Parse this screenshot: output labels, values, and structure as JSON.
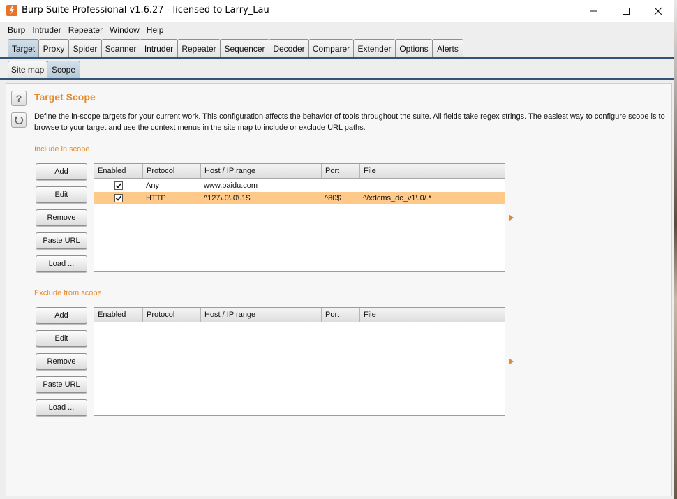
{
  "window": {
    "title": "Burp Suite Professional v1.6.27 - licensed to Larry_Lau"
  },
  "menu": [
    "Burp",
    "Intruder",
    "Repeater",
    "Window",
    "Help"
  ],
  "main_tabs": [
    "Target",
    "Proxy",
    "Spider",
    "Scanner",
    "Intruder",
    "Repeater",
    "Sequencer",
    "Decoder",
    "Comparer",
    "Extender",
    "Options",
    "Alerts"
  ],
  "active_main_tab": "Target",
  "sub_tabs": [
    "Site map",
    "Scope"
  ],
  "active_sub_tab": "Scope",
  "scope": {
    "title": "Target Scope",
    "description": "Define the in-scope targets for your current work. This configuration affects the behavior of tools throughout the suite. All fields take regex strings. The easiest way to configure scope is to browse to your target and use the context menus in the site map to include or exclude URL paths.",
    "help_icon": "?",
    "include": {
      "label": "Include in scope",
      "buttons": [
        "Add",
        "Edit",
        "Remove",
        "Paste URL",
        "Load ..."
      ],
      "columns": [
        "Enabled",
        "Protocol",
        "Host / IP range",
        "Port",
        "File"
      ],
      "rows": [
        {
          "enabled": true,
          "protocol": "Any",
          "host": "www.baidu.com",
          "port": "",
          "file": "",
          "selected": false
        },
        {
          "enabled": true,
          "protocol": "HTTP",
          "host": "^127\\.0\\.0\\.1$",
          "port": "^80$",
          "file": "^/xdcms_dc_v1\\.0/.*",
          "selected": true
        }
      ]
    },
    "exclude": {
      "label": "Exclude from scope",
      "buttons": [
        "Add",
        "Edit",
        "Remove",
        "Paste URL",
        "Load ..."
      ],
      "columns": [
        "Enabled",
        "Protocol",
        "Host / IP range",
        "Port",
        "File"
      ],
      "rows": []
    }
  },
  "colors": {
    "accent_orange": "#e58a2e",
    "selected_row": "#ffc98a",
    "active_tab": "#b6c9d7",
    "tab_underline": "#33557a"
  }
}
